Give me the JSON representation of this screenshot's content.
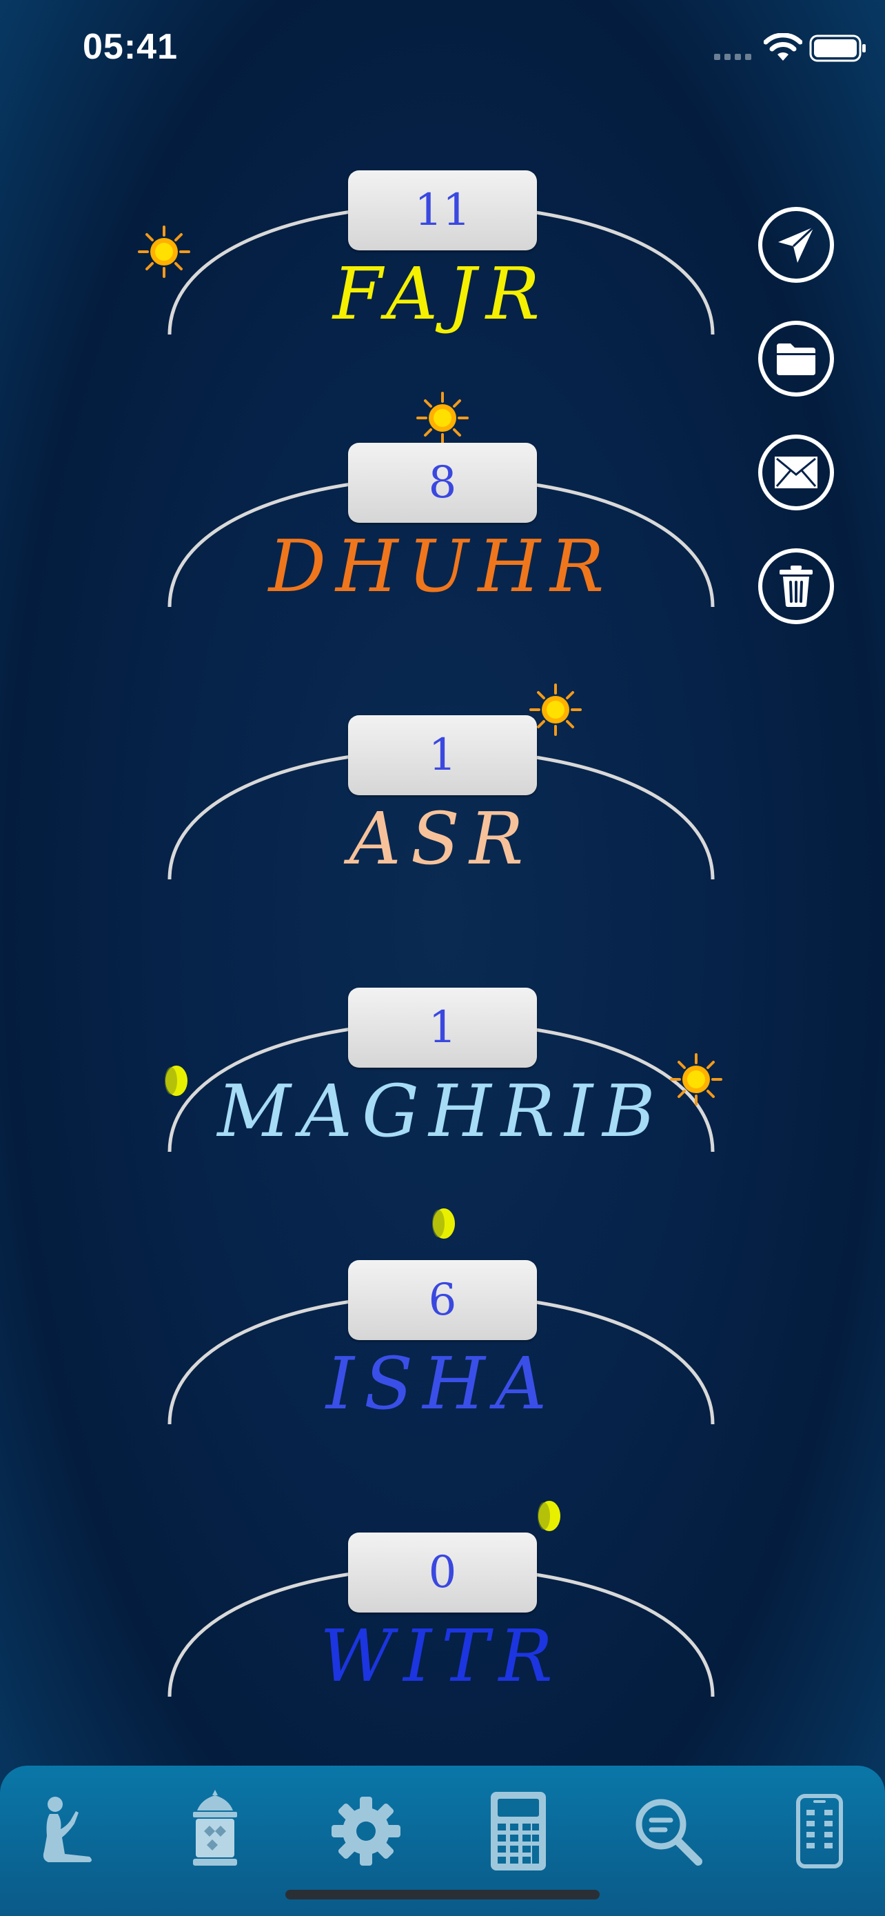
{
  "status_bar": {
    "time": "05:41"
  },
  "prayers": [
    {
      "name": "Fajr",
      "count": "11",
      "color": "#f4f000",
      "sky": "sun"
    },
    {
      "name": "Dhuhr",
      "count": "8",
      "color": "#f0761c",
      "sky": "sun"
    },
    {
      "name": "Asr",
      "count": "1",
      "color": "#f7c29a",
      "sky": "sun"
    },
    {
      "name": "Maghrib",
      "count": "1",
      "color": "#a6dcf5",
      "sky": "sun-and-moon"
    },
    {
      "name": "Isha",
      "count": "6",
      "color": "#3a4fe8",
      "sky": "moon"
    },
    {
      "name": "Witr",
      "count": "0",
      "color": "#1c35e0",
      "sky": "moon"
    }
  ],
  "side_actions": [
    "send-icon",
    "folder-icon",
    "mail-icon",
    "trash-icon"
  ],
  "tabs": [
    "prayer-person-icon",
    "lantern-icon",
    "gear-icon",
    "calculator-icon",
    "search-icon",
    "phone-icon"
  ],
  "colors": {
    "count_text": "#3a48e0",
    "tab_icon": "#9fc7dc",
    "arc": "#d9d9d9"
  }
}
